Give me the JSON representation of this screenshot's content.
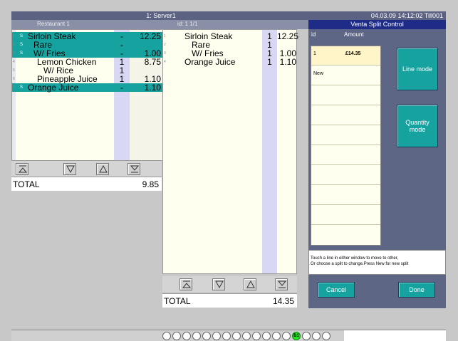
{
  "titlebar": {
    "server": "1: Server1",
    "datetime": "04.03.09 14:12:02 Till001"
  },
  "subbar": {
    "restaurant": "Restaurant 1",
    "order_id": "id: 1   1/1",
    "panel_title": "Venta Split Control"
  },
  "left_list": {
    "rows": [
      {
        "num": "1",
        "flag": "S",
        "name": "Sirloin Steak",
        "qty": "-",
        "price": "12.25",
        "highlighted": true
      },
      {
        "num": "2",
        "flag": "S",
        "name": "  Rare",
        "qty": "-",
        "price": "",
        "highlighted": true
      },
      {
        "num": "3",
        "flag": "S",
        "name": "  W/ Fries",
        "qty": "-",
        "price": "1.00",
        "highlighted": true
      },
      {
        "num": "4",
        "flag": "",
        "name": "Lemon Chicken",
        "qty": "1",
        "price": "8.75",
        "highlighted": false
      },
      {
        "num": "5",
        "flag": "",
        "name": "  W/ Rice",
        "qty": "1",
        "price": "",
        "highlighted": false
      },
      {
        "num": "6",
        "flag": "",
        "name": "Pineapple Juice",
        "qty": "1",
        "price": "1.10",
        "highlighted": false
      },
      {
        "num": "7",
        "flag": "S",
        "name": "Orange Juice",
        "qty": "-",
        "price": "1.10",
        "highlighted": true
      }
    ],
    "total_label": "TOTAL",
    "total_value": "9.85"
  },
  "mid_list": {
    "rows": [
      {
        "num": "1",
        "name": "Sirloin Steak",
        "qty": "1",
        "price": "12.25"
      },
      {
        "num": "2",
        "name": "  Rare",
        "qty": "1",
        "price": ""
      },
      {
        "num": "3",
        "name": "  W/ Fries",
        "qty": "1",
        "price": "1.00"
      },
      {
        "num": "4",
        "name": "Orange Juice",
        "qty": "1",
        "price": "1.10"
      }
    ],
    "total_label": "TOTAL",
    "total_value": "14.35"
  },
  "split_control": {
    "col_id": "id",
    "col_amount": "Amount",
    "splits": [
      {
        "id": "1",
        "amount": "£14.35"
      },
      {
        "id": "New",
        "amount": ""
      }
    ],
    "line_mode_label": "Line mode",
    "quantity_mode_label": "Quantity mode",
    "info_line1": "Touch a line in either window to move to other,",
    "info_line2": "Or choose a split to change.Press New for new split",
    "cancel_label": "Cancel",
    "done_label": "Done"
  },
  "bottom": {
    "active_circle_label": "B1"
  },
  "colors": {
    "highlight": "#16a3a0",
    "panel": "#5e6685",
    "header": "#1e2c88",
    "active": "#22e322"
  }
}
